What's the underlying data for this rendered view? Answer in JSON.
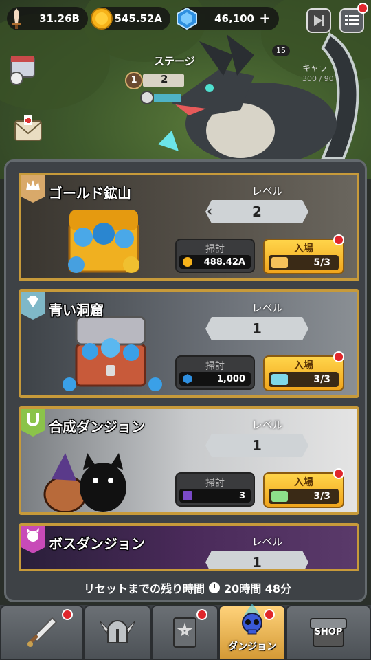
{
  "currencies": {
    "power": "31.26B",
    "gold": "545.52A",
    "gems": "46,100",
    "gems_plus": "+"
  },
  "stage": {
    "label": "ステージ",
    "stage_count": "15",
    "step_current": "1",
    "step_next": "2",
    "character_label": "キャラ",
    "character_progress": "300 / 90"
  },
  "dungeons": [
    {
      "title": "ゴールド鉱山",
      "level_label": "レベル",
      "level": "2",
      "sweep_label": "掃討",
      "sweep_value": "488.42A",
      "enter_label": "入場",
      "enter_value": "5/3",
      "theme": "#8a7a5a"
    },
    {
      "title": "青い洞窟",
      "level_label": "レベル",
      "level": "1",
      "sweep_label": "掃討",
      "sweep_value": "1,000",
      "enter_label": "入場",
      "enter_value": "3/3",
      "theme": "#5a6a78"
    },
    {
      "title": "合成ダンジョン",
      "level_label": "レベル",
      "level": "1",
      "sweep_label": "掃討",
      "sweep_value": "3",
      "enter_label": "入場",
      "enter_value": "3/3",
      "theme": "#c8c8c8"
    },
    {
      "title": "ボスダンジョン",
      "level_label": "レベル",
      "level": "1"
    }
  ],
  "timer": {
    "label": "リセットまでの残り時間",
    "value": "20時間 48分"
  },
  "nav": {
    "weapon": "weapon-sword-icon",
    "armor": "helmet-icon",
    "book": "spellbook-icon",
    "dungeon_label": "ダンジョン",
    "shop_label": "SHOP"
  },
  "colors": {
    "accent_gold": "#f0a51c",
    "card_border": "#c79a3a",
    "notification": "#e0262b"
  }
}
